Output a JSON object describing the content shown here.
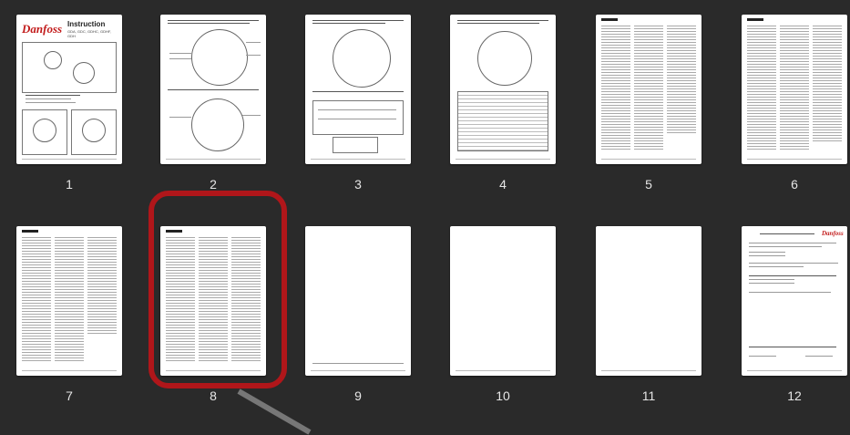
{
  "pages": [
    {
      "number": "1",
      "logo": "Danfoss",
      "title": "Instruction",
      "subtitle": "GDA, GDC, GDHC, GDHF, GDH"
    },
    {
      "number": "2"
    },
    {
      "number": "3"
    },
    {
      "number": "4"
    },
    {
      "number": "5"
    },
    {
      "number": "6"
    },
    {
      "number": "7"
    },
    {
      "number": "8",
      "selected": true
    },
    {
      "number": "9"
    },
    {
      "number": "10"
    },
    {
      "number": "11"
    },
    {
      "number": "12",
      "logo": "Danfoss"
    }
  ],
  "colors": {
    "background": "#2a2a2a",
    "highlight": "#b0161a",
    "page": "#ffffff"
  }
}
